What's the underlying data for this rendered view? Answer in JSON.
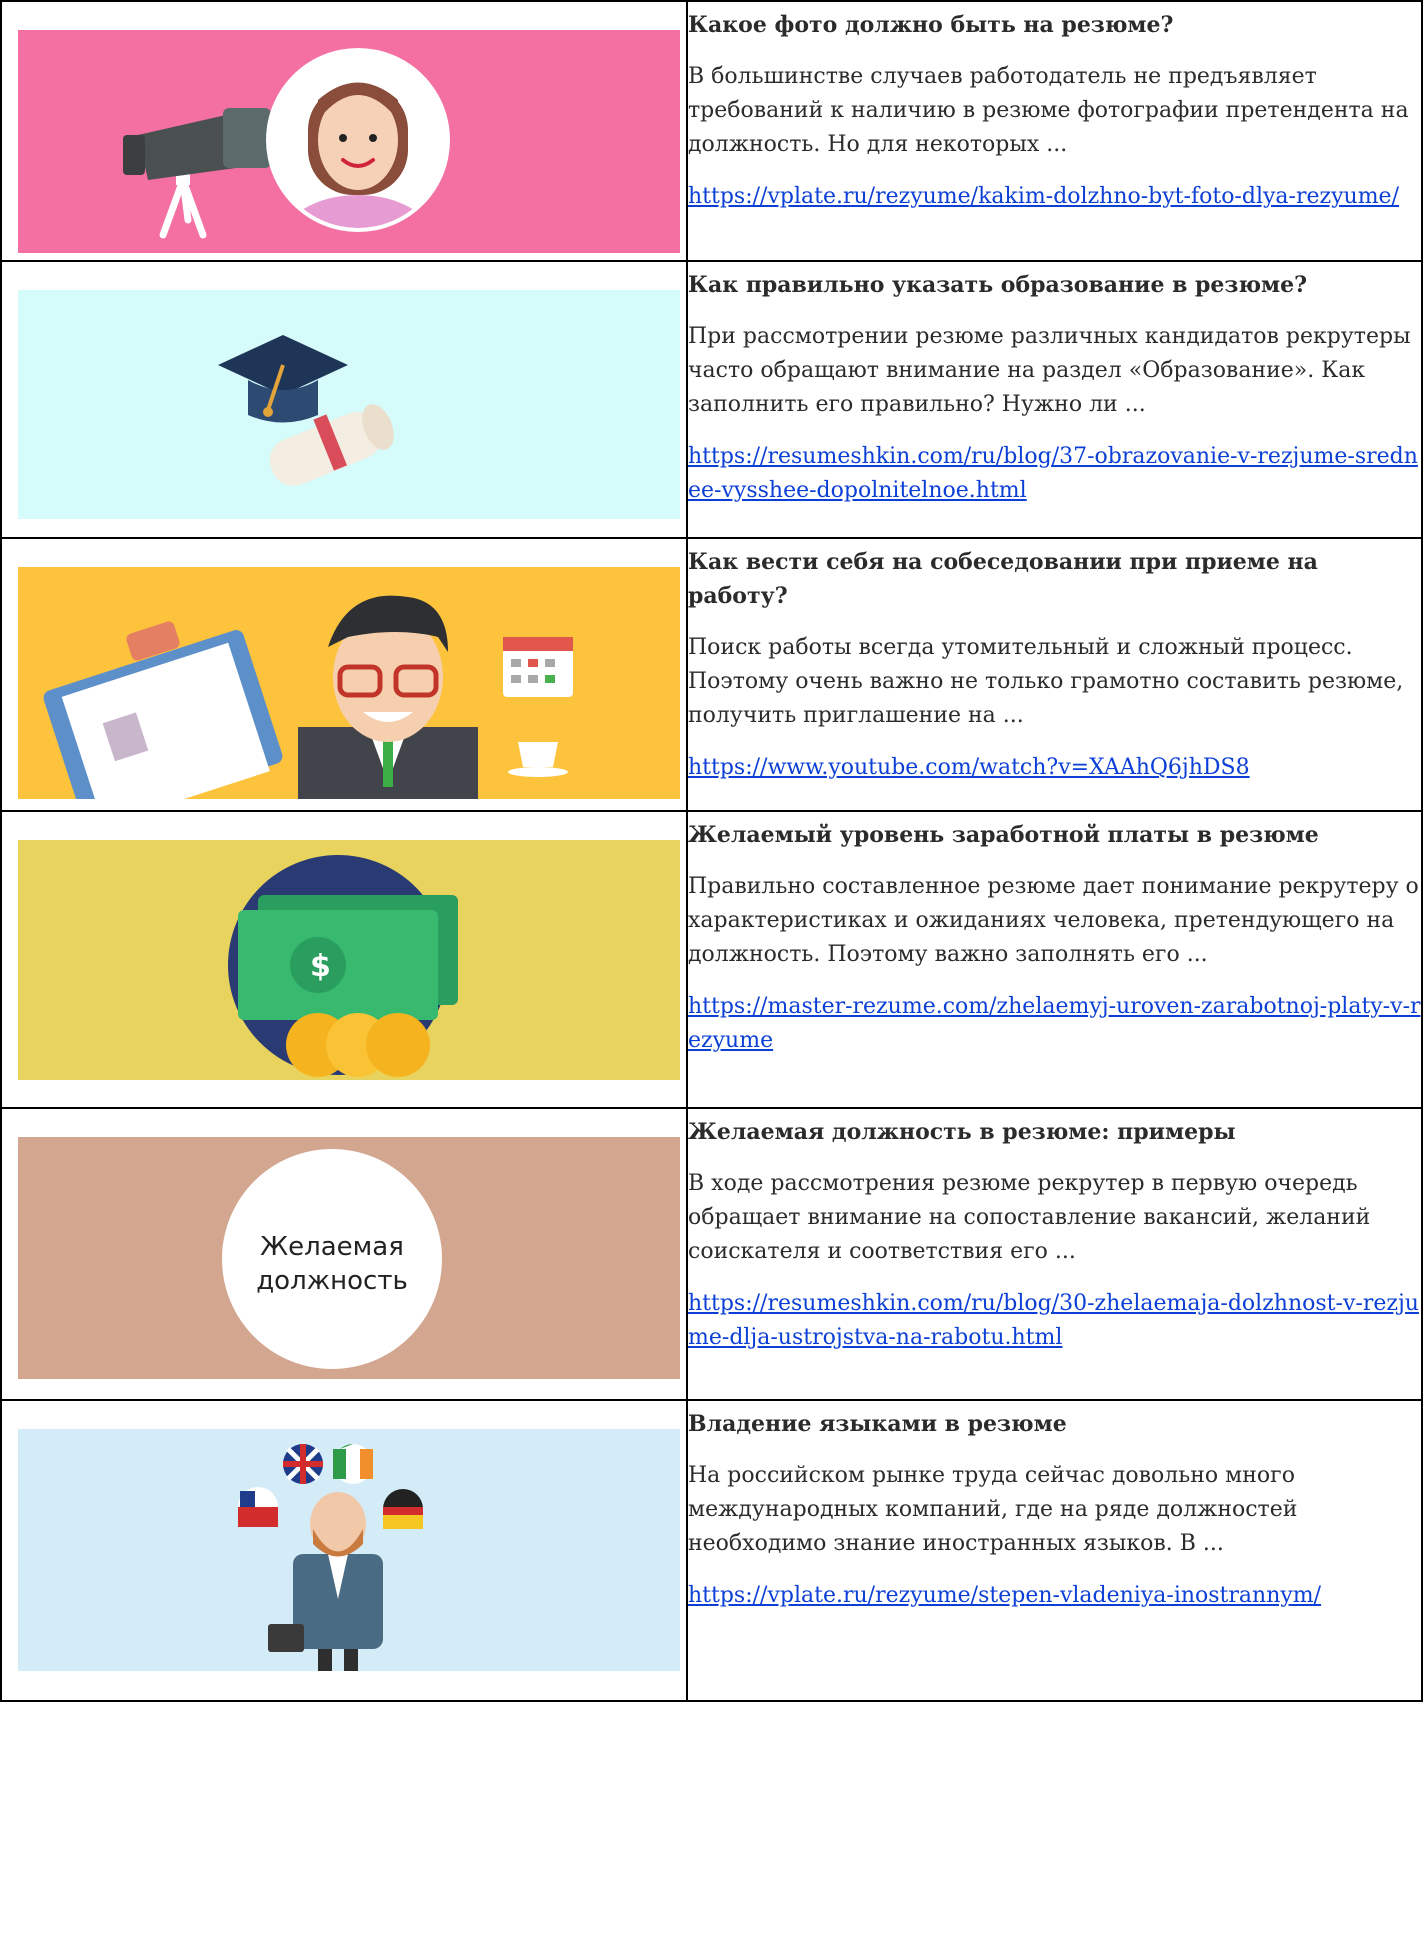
{
  "rows": [
    {
      "title": "Какое фото должно быть на резюме?",
      "description": "В большинстве случаев работодатель не предъявляет требований к наличию в резюме фотографии претендента на должность. Но для некоторых ...",
      "link": "https://vplate.ru/rezyume/kakim-dolzhno-byt-foto-dlya-rezyume/",
      "image_bg": "#f46fa2"
    },
    {
      "title": "Как правильно указать образование в резюме?",
      "description": "При рассмотрении резюме различных кандидатов рекрутеры часто обращают внимание на раздел «Образование». Как заполнить его правильно? Нужно ли ...",
      "link": "https://resumeshkin.com/ru/blog/37-obrazovanie-v-rezjume-srednee-vysshee-dopolnitelnoe.html",
      "image_bg": "#d6fbfb"
    },
    {
      "title": "Как вести себя на собеседовании при приеме на работу?",
      "description": "Поиск работы всегда утомительный и сложный процесс. Поэтому очень важно не только грамотно составить резюме, получить приглашение на ...",
      "link": "https://www.youtube.com/watch?v=XAAhQ6jhDS8",
      "image_bg": "#fdc33d"
    },
    {
      "title": "Желаемый уровень заработной платы в резюме",
      "description": "Правильно составленное резюме дает понимание рекрутеру о характеристиках и ожиданиях человека, претендующего на должность. Поэтому важно заполнять его ...",
      "link": "https://master-rezume.com/zhelaemyj-uroven-zarabotnoj-platy-v-rezyume",
      "image_bg": "#e7d35e"
    },
    {
      "title": "Желаемая должность в резюме: примеры",
      "description": "В ходе рассмотрения резюме рекрутер в первую очередь обращает внимание на сопоставление вакансий, желаний соискателя и соответствия его ...",
      "link": "https://resumeshkin.com/ru/blog/30-zhelaemaja-dolzhnost-v-rezjume-dlja-ustrojstva-na-rabotu.html",
      "image_bg": "#d3a690",
      "image_text_1": "Желаемая",
      "image_text_2": "должность"
    },
    {
      "title": "Владение языками в резюме",
      "description": "На российском рынке труда сейчас довольно много международных компаний, где на ряде должностей необходимо знание иностранных языков. В ...",
      "link": "https://vplate.ru/rezyume/stepen-vladeniya-inostrannym/",
      "image_bg": "#d3ecf7"
    }
  ]
}
